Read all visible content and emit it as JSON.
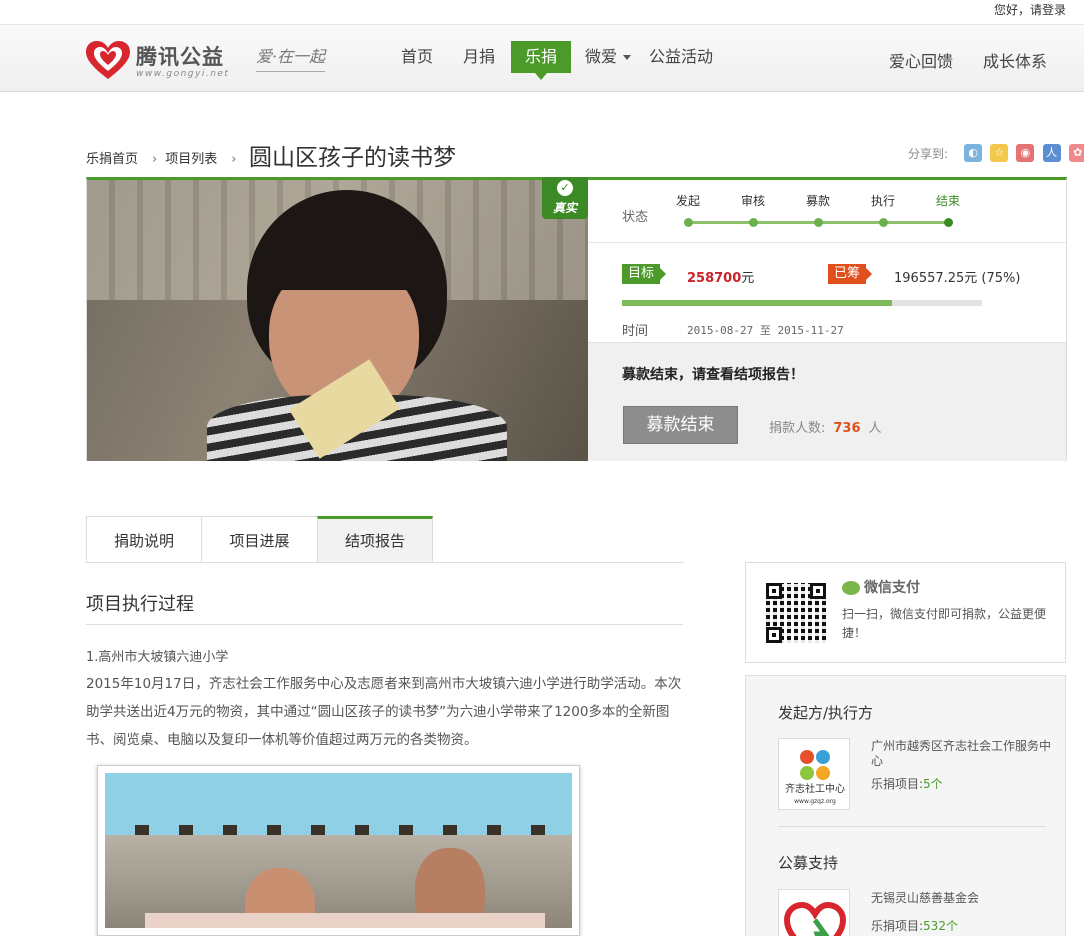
{
  "topbar": {
    "greeting": "您好，请",
    "login": "登录"
  },
  "header": {
    "logo_text": "腾讯公益",
    "logo_url_text": "www.gongyi.net",
    "slogan": "爱·在一起",
    "nav": [
      "首页",
      "月捐",
      "乐捐",
      "微爱",
      "公益活动"
    ],
    "nav_active": "乐捐",
    "right_nav": [
      "爱心回馈",
      "成长体系"
    ]
  },
  "breadcrumb": [
    "乐捐首页",
    "项目列表"
  ],
  "page_title": "圆山区孩子的读书梦",
  "share": {
    "label": "分享到:",
    "icons": [
      "qzone-icon",
      "star-icon",
      "weibo-icon",
      "renren-icon",
      "tencent-weibo-icon"
    ]
  },
  "project": {
    "badge": "真实",
    "status_label": "状态",
    "steps": [
      "发起",
      "审核",
      "募款",
      "执行",
      "结束"
    ],
    "current_step": "结束",
    "goal_label": "目标",
    "goal_amount": "258700",
    "goal_unit": "元",
    "raised_label": "已筹",
    "raised_text": "196557.25元  (75%)",
    "progress_fraction": 0.75,
    "time_label": "时间",
    "time_range": "2015-08-27 至 2015-11-27",
    "end_message": "募款结束，请查看结项报告！",
    "end_button": "募款结束",
    "donors_label": "捐款人数:",
    "donors_count": "736",
    "donors_unit": "人"
  },
  "tabs": [
    "捐助说明",
    "项目进展",
    "结项报告"
  ],
  "active_tab": "结项报告",
  "article": {
    "section_title": "项目执行过程",
    "subtitle": "1.高州市大坡镇六迪小学",
    "body": "2015年10月17日，齐志社会工作服务中心及志愿者来到高州市大坡镇六迪小学进行助学活动。本次助学共送出近4万元的物资，其中通过“圆山区孩子的读书梦”为六迪小学带来了1200多本的全新图书、阅览桌、电脑以及复印一体机等价值超过两万元的各类物资。"
  },
  "wechat": {
    "title": "微信支付",
    "desc": "扫一扫，微信支付即可捐款，公益更便捷！"
  },
  "org": {
    "sponsor_title": "发起方/执行方",
    "sponsor_name": "广州市越秀区齐志社会工作服务中心",
    "sponsor_count_label": "乐捐项目:",
    "sponsor_count": "5个",
    "sponsor_logo_text": "齐志社工中心",
    "sponsor_logo_url": "www.gzqz.org",
    "support_title": "公募支持",
    "support_name": "无锡灵山慈善基金会",
    "support_count_label": "乐捐项目:",
    "support_count": "532个"
  },
  "colors": {
    "brand_green": "#4c9a2a",
    "goal_red": "#c9242a",
    "raised_orange": "#e1501c"
  }
}
